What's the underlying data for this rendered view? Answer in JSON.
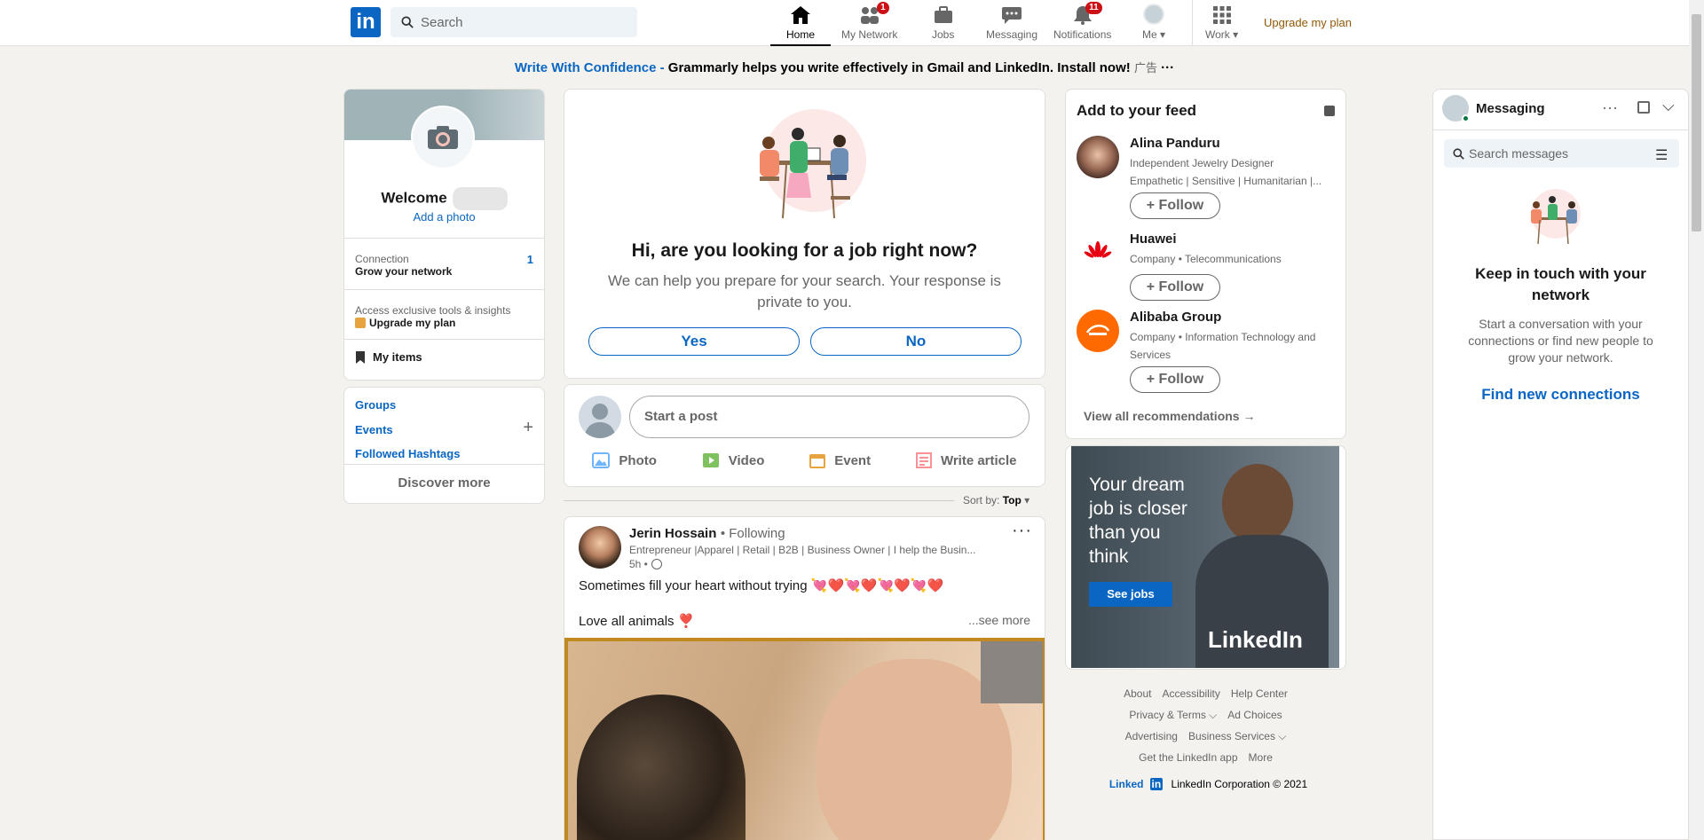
{
  "nav": {
    "logo": "in",
    "search_placeholder": "Search",
    "items": [
      {
        "label": "Home"
      },
      {
        "label": "My Network",
        "badge": "1"
      },
      {
        "label": "Jobs"
      },
      {
        "label": "Messaging"
      },
      {
        "label": "Notifications",
        "badge": "11"
      },
      {
        "label": "Me"
      },
      {
        "label": "Work"
      }
    ],
    "upgrade": "Upgrade my plan"
  },
  "ad_line": {
    "link": "Write With Confidence -",
    "text": "Grammarly helps you write effectively in Gmail and LinkedIn. Install now!",
    "tag": "广告",
    "more": "···"
  },
  "profile": {
    "welcome": "Welcome",
    "add_photo": "Add a photo",
    "connection_label": "Connection",
    "connection_sub": "Grow your network",
    "connection_count": "1",
    "access_text": "Access exclusive tools & insights",
    "upgrade": "Upgrade my plan",
    "my_items": "My items"
  },
  "links": {
    "groups": "Groups",
    "events": "Events",
    "hashtags": "Followed Hashtags",
    "discover": "Discover more"
  },
  "jobcard": {
    "question": "Hi, are you looking for a job right now?",
    "sub": "We can help you prepare for your search. Your response is private to you.",
    "yes": "Yes",
    "no": "No"
  },
  "composer": {
    "placeholder": "Start a post",
    "photo": "Photo",
    "video": "Video",
    "event": "Event",
    "article": "Write article"
  },
  "sort": {
    "label": "Sort by:",
    "value": "Top"
  },
  "post": {
    "author": "Jerin Hossain",
    "following": "• Following",
    "headline": "Entrepreneur |Apparel | Retail | B2B | Business Owner | I help the Busin...",
    "time": "5h •",
    "text1": "Sometimes fill your heart without trying 💘❤️💘❤️💘❤️💘❤️",
    "text2": "Love all animals ❣️",
    "see_more": "...see more"
  },
  "recommend": {
    "title": "Add to your feed",
    "items": [
      {
        "name": "Alina Panduru",
        "desc1": "Independent Jewelry Designer",
        "desc2": "Empathetic | Sensitive | Humanitarian |..."
      },
      {
        "name": "Huawei",
        "desc1": "Company • Telecommunications",
        "desc2": ""
      },
      {
        "name": "Alibaba Group",
        "desc1": "Company • Information Technology and Services",
        "desc2": ""
      }
    ],
    "follow": "+ Follow",
    "view_all": "View all recommendations →"
  },
  "ad": {
    "headline": "Your dream job is closer than you think",
    "button": "See jobs",
    "brand": "LinkedIn"
  },
  "footer": {
    "row1": [
      "About",
      "Accessibility",
      "Help Center"
    ],
    "row2": [
      "Privacy & Terms ⌵",
      "Ad Choices"
    ],
    "row3": [
      "Advertising",
      "Business Services ⌵"
    ],
    "row4": [
      "Get the LinkedIn app",
      "More"
    ],
    "copyright": "LinkedIn Corporation © 2021",
    "brand": "Linked"
  },
  "messaging": {
    "title": "Messaging",
    "search_placeholder": "Search messages",
    "heading": "Keep in touch with your network",
    "sub": "Start a conversation with your connections or find new people to grow your network.",
    "link": "Find new connections"
  }
}
